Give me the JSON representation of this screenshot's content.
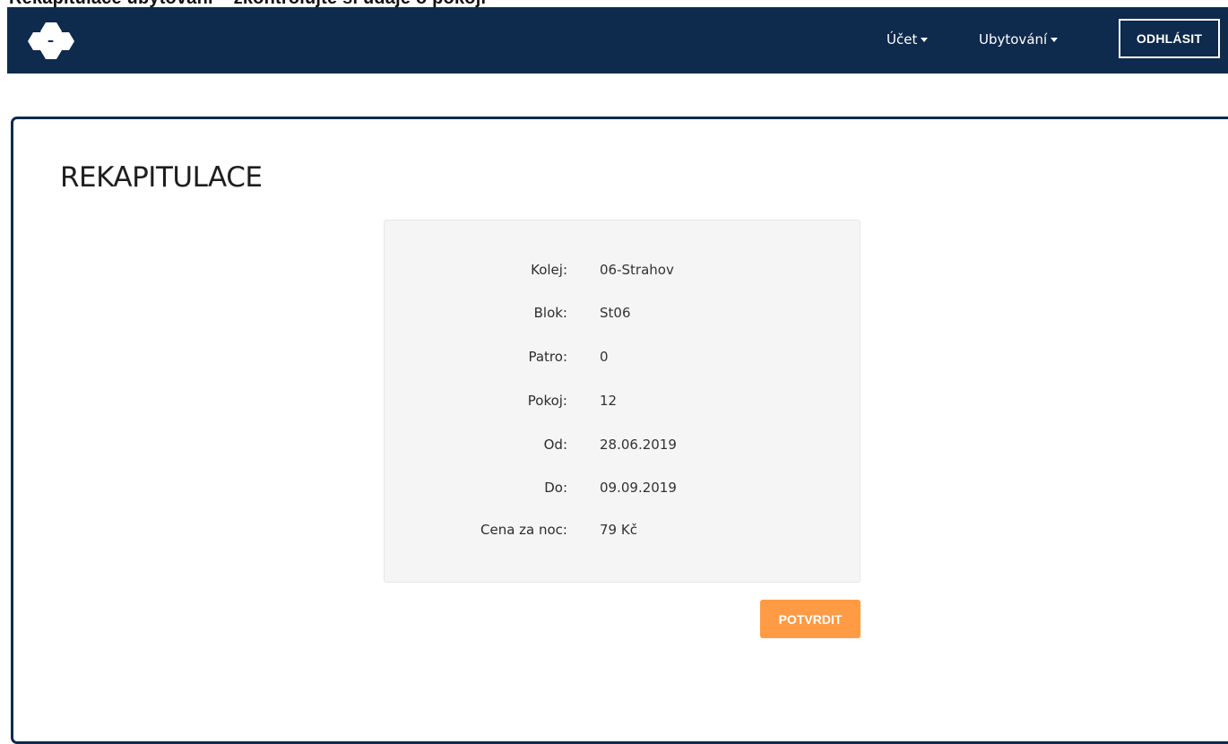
{
  "header": {
    "cropped_heading": "Rekapitulace ubytování – zkontrolujte si údaje o pokoji",
    "logo_icon": "hexagon-cluster-logo-icon",
    "nav": [
      {
        "label": "Účet"
      },
      {
        "label": "Ubytování"
      }
    ],
    "logout_label": "ODHLÁSIT",
    "background_color": "#0e2a4c"
  },
  "main": {
    "title": "REKAPITULACE",
    "summary": {
      "rows": [
        {
          "label": "Kolej:",
          "value": "06-Strahov"
        },
        {
          "label": "Blok:",
          "value": "St06"
        },
        {
          "label": "Patro:",
          "value": "0"
        },
        {
          "label": "Pokoj:",
          "value": "12"
        },
        {
          "label": "Od:",
          "value": "28.06.2019"
        },
        {
          "label": "Do:",
          "value": "09.09.2019"
        },
        {
          "label": "Cena za noc:",
          "value": "79 Kč"
        }
      ]
    },
    "confirm_label": "POTVRDIT",
    "accent_color": "#ff9b45"
  }
}
